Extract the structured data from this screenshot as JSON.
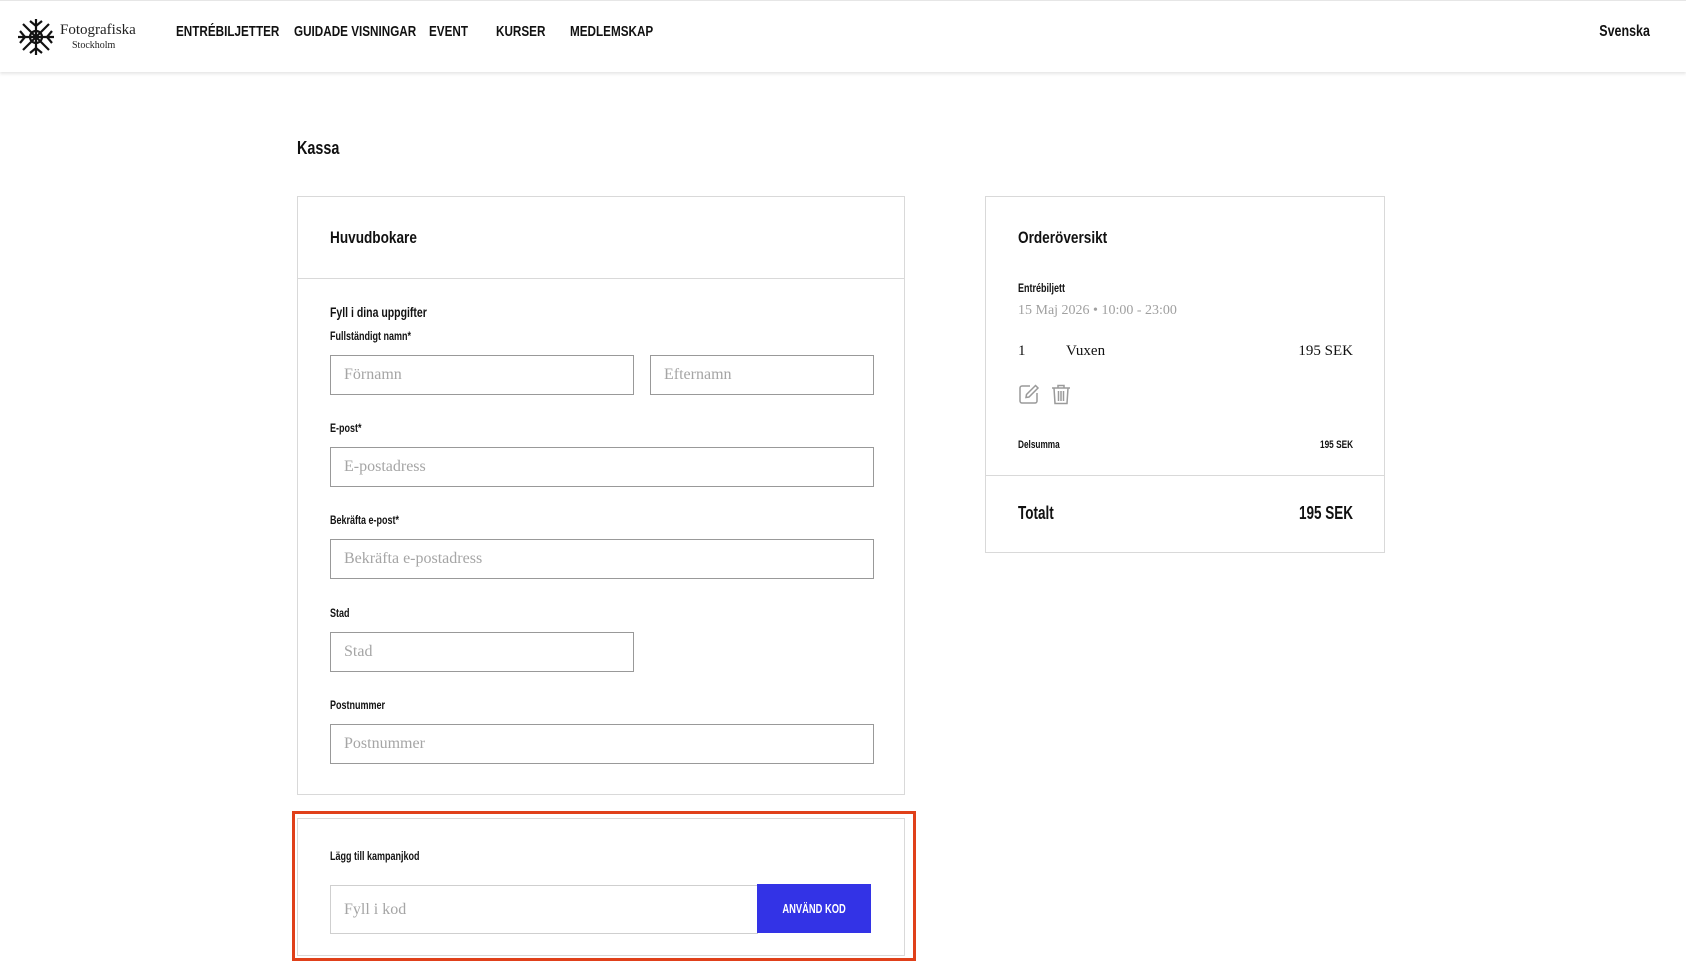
{
  "header": {
    "logo_name": "Fotografiska",
    "logo_city": "Stockholm",
    "nav": [
      {
        "label": "ENTRÉBILJETTER"
      },
      {
        "label": "GUIDADE VISNINGAR"
      },
      {
        "label": "EVENT"
      },
      {
        "label": "KURSER"
      },
      {
        "label": "MEDLEMSKAP"
      }
    ],
    "language": "Svenska"
  },
  "page_title": "Kassa",
  "booker": {
    "heading": "Huvudbokare",
    "intro": "Fyll i dina uppgifter",
    "fullname_label": "Fullständigt namn*",
    "firstname_placeholder": "Förnamn",
    "lastname_placeholder": "Efternamn",
    "email_label": "E-post*",
    "email_placeholder": "E-postadress",
    "confirm_email_label": "Bekräfta e-post*",
    "confirm_email_placeholder": "Bekräfta e-postadress",
    "city_label": "Stad",
    "city_placeholder": "Stad",
    "postal_label": "Postnummer",
    "postal_placeholder": "Postnummer"
  },
  "promo": {
    "label": "Lägg till kampanjkod",
    "placeholder": "Fyll i kod",
    "button": "ANVÄND KOD"
  },
  "order": {
    "heading": "Orderöversikt",
    "ticket_title": "Entrébiljett",
    "ticket_date": "15 Maj 2026 • 10:00 - 23:00",
    "line": {
      "qty": "1",
      "type": "Vuxen",
      "price": "195 SEK"
    },
    "edit_icon": "edit-icon",
    "delete_icon": "trash-icon",
    "subtotal_label": "Delsumma",
    "subtotal_value": "195 SEK",
    "total_label": "Totalt",
    "total_value": "195 SEK"
  },
  "colors": {
    "accent": "#3333e6",
    "highlight": "#e0401a"
  }
}
